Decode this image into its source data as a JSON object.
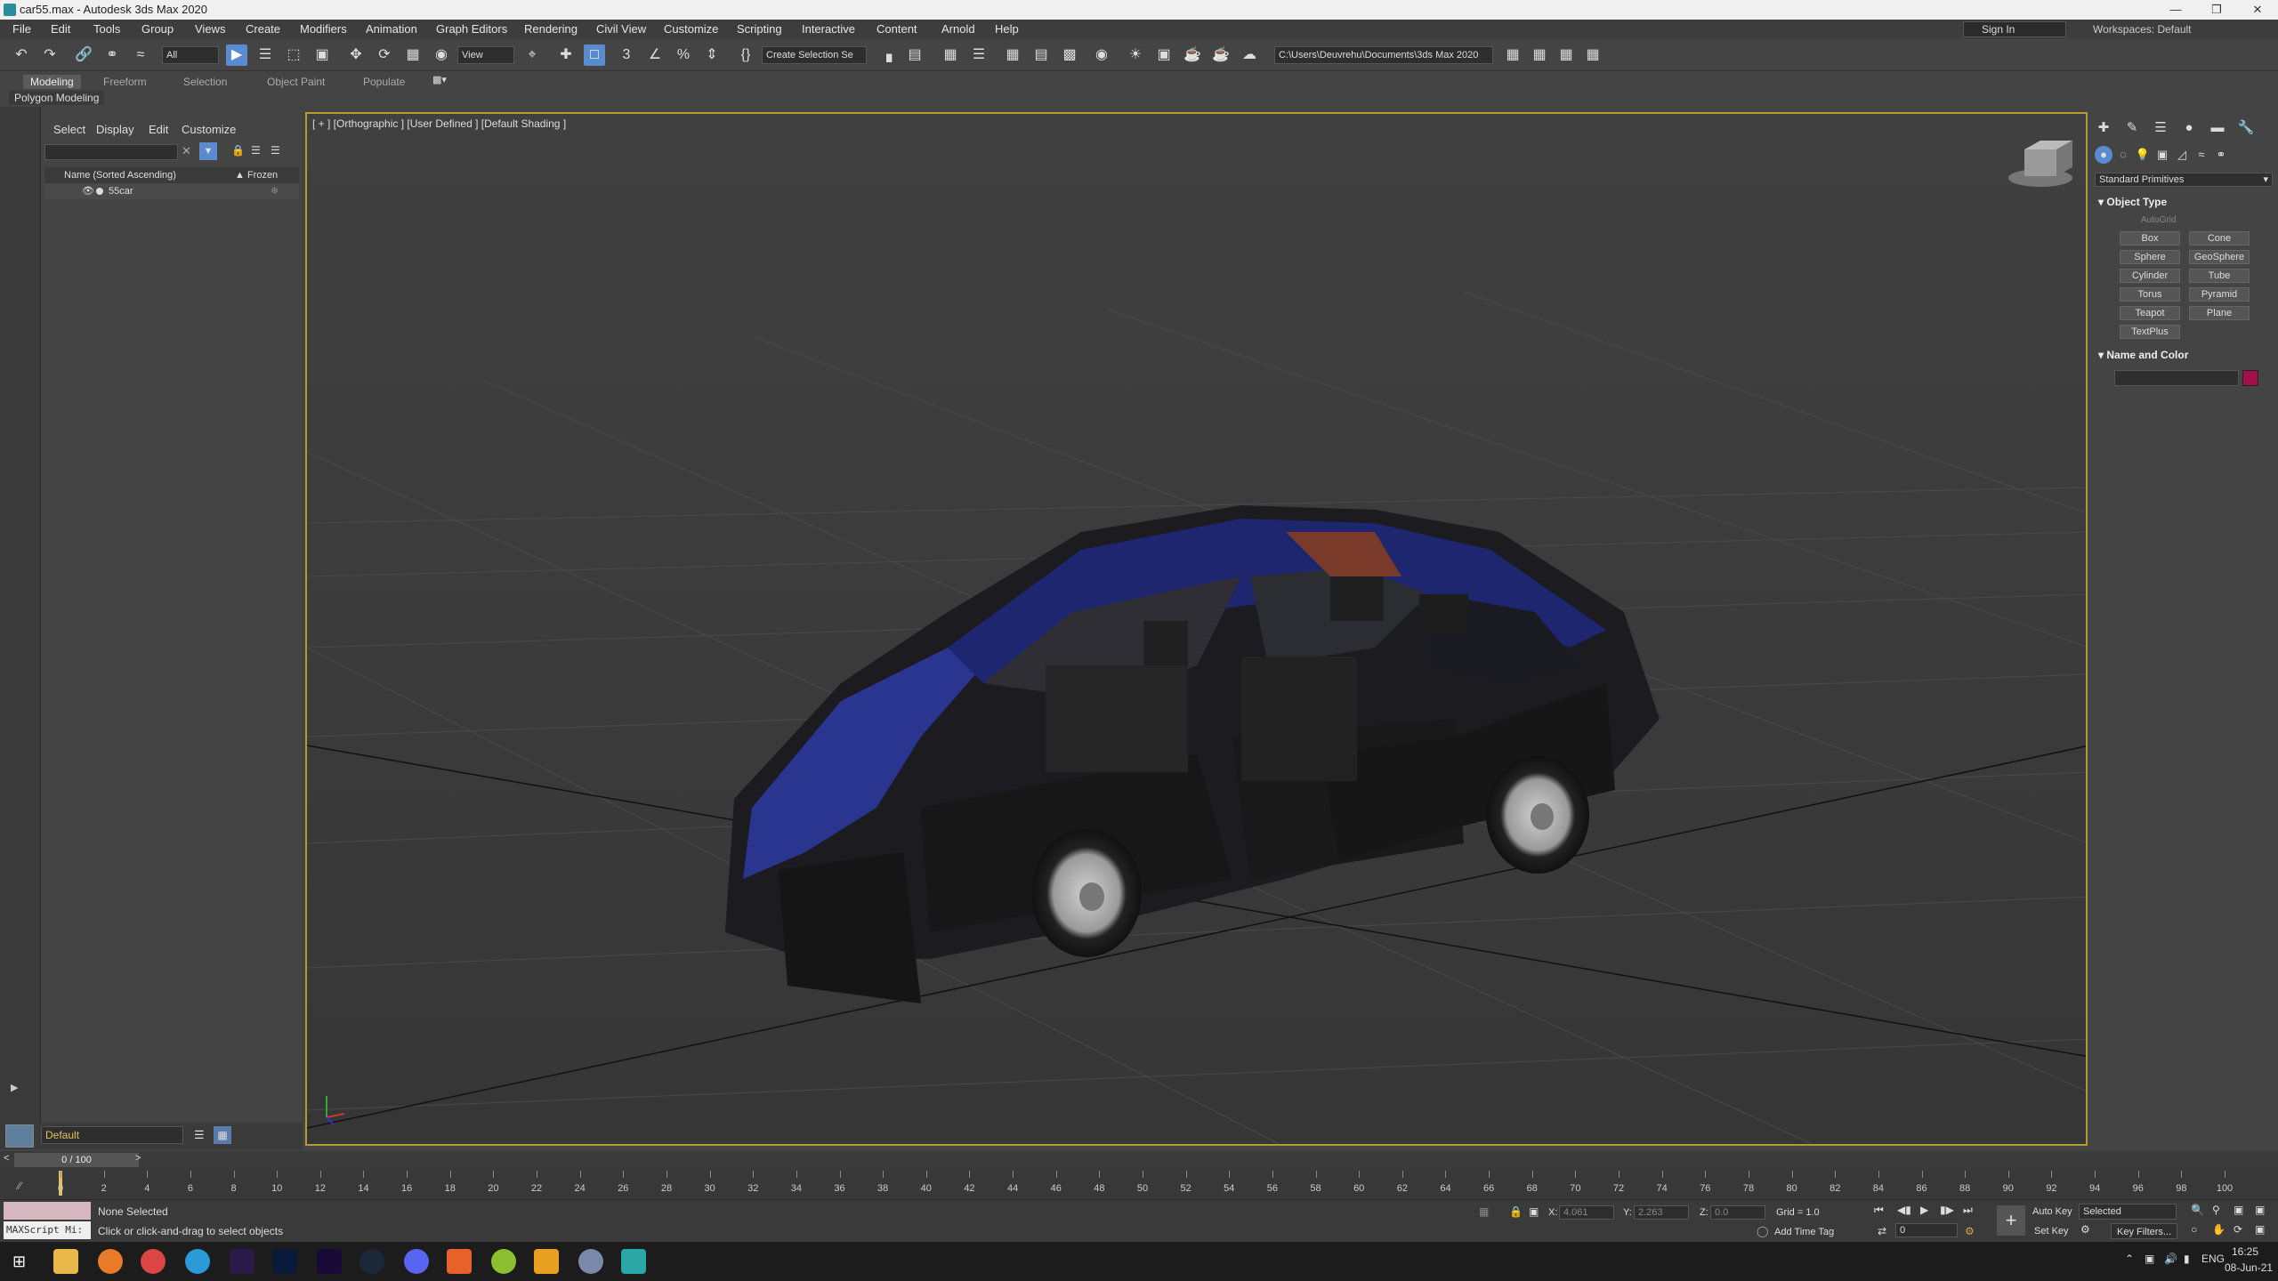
{
  "window": {
    "title": "car55.max - Autodesk 3ds Max 2020"
  },
  "menu": [
    "File",
    "Edit",
    "Tools",
    "Group",
    "Views",
    "Create",
    "Modifiers",
    "Animation",
    "Graph Editors",
    "Rendering",
    "Civil View",
    "Customize",
    "Scripting",
    "Interactive",
    "Content",
    "Arnold",
    "Help"
  ],
  "account": {
    "sign_in": "Sign In",
    "workspaces": "Workspaces: Default"
  },
  "toolbar": {
    "filter": "All",
    "ref_coord": "View",
    "named_selection": "Create Selection Se",
    "project_path": "C:\\Users\\Deuvrehu\\Documents\\3ds Max 2020"
  },
  "ribbon": {
    "tabs": [
      "Modeling",
      "Freeform",
      "Selection",
      "Object Paint",
      "Populate"
    ],
    "active_tab": "Modeling",
    "panel": "Polygon Modeling"
  },
  "explorer": {
    "menus": [
      "Select",
      "Display",
      "Edit",
      "Customize"
    ],
    "col_name": "Name (Sorted Ascending)",
    "col_frozen": "▲ Frozen",
    "rows": [
      {
        "name": "55car"
      }
    ]
  },
  "viewport": {
    "label": "[ + ] [Orthographic ] [User Defined ] [Default Shading ]"
  },
  "cmdpanel": {
    "category": "Standard Primitives",
    "object_type_title": "Object Type",
    "autogrid": "AutoGrid",
    "buttons": [
      "Box",
      "Cone",
      "Sphere",
      "GeoSphere",
      "Cylinder",
      "Tube",
      "Torus",
      "Pyramid",
      "Teapot",
      "Plane",
      "TextPlus"
    ],
    "name_color_title": "Name and Color",
    "color": "#a0104a"
  },
  "layer": {
    "name": "Default"
  },
  "timeline": {
    "frame_indicator": "0 / 100",
    "ticks": [
      0,
      2,
      4,
      6,
      8,
      10,
      12,
      14,
      16,
      18,
      20,
      22,
      24,
      26,
      28,
      30,
      32,
      34,
      36,
      38,
      40,
      42,
      44,
      46,
      48,
      50,
      52,
      54,
      56,
      58,
      60,
      62,
      64,
      66,
      68,
      70,
      72,
      74,
      76,
      78,
      80,
      82,
      84,
      86,
      88,
      90,
      92,
      94,
      96,
      98,
      100
    ]
  },
  "status": {
    "maxscript": "MAXScript Mi:",
    "selection": "None Selected",
    "prompt": "Click or click-and-drag to select objects",
    "x_label": "X:",
    "x_value": "4.061",
    "y_label": "Y:",
    "y_value": "2.263",
    "z_label": "Z:",
    "z_value": "0.0",
    "grid": "Grid = 1.0",
    "add_time_tag": "Add Time Tag",
    "auto_key": "Auto Key",
    "set_key": "Set Key",
    "selected": "Selected",
    "key_filters": "Key Filters...",
    "frame": "0"
  },
  "taskbar": {
    "lang": "ENG",
    "time": "16:25",
    "date": "08-Jun-21"
  }
}
